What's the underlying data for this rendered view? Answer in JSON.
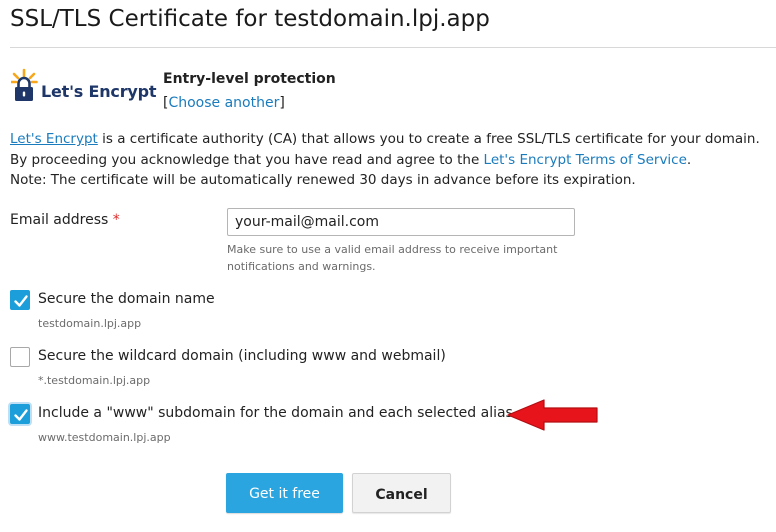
{
  "page": {
    "title": "SSL/TLS Certificate for testdomain.lpj.app"
  },
  "provider": {
    "logo_text": "Let's Encrypt",
    "level": "Entry-level protection",
    "choose_prefix": "[",
    "choose_link": "Choose another",
    "choose_suffix": "]",
    "logo_colors": {
      "text": "#1e3768",
      "rays": "#f7a71b",
      "lock": "#1e3768"
    }
  },
  "description": {
    "line1_link": "Let's Encrypt",
    "line1_text": " is a certificate authority (CA) that allows you to create a free SSL/TLS certificate for your domain.",
    "line2_text": "By proceeding you acknowledge that you have read and agree to the ",
    "line2_link": "Let's Encrypt Terms of Service",
    "line2_end": ".",
    "line3_text": "Note: The certificate will be automatically renewed 30 days in advance before its expiration."
  },
  "email": {
    "label": "Email address",
    "required_mark": "*",
    "value": "your-mail@mail.com",
    "hint": "Make sure to use a valid email address to receive important notifications and warnings."
  },
  "options": [
    {
      "label": "Secure the domain name",
      "sub": "testdomain.lpj.app",
      "checked": true
    },
    {
      "label": "Secure the wildcard domain (including www and webmail)",
      "sub": "*.testdomain.lpj.app",
      "checked": false
    },
    {
      "label": "Include a \"www\" subdomain for the domain and each selected alias",
      "sub": "www.testdomain.lpj.app",
      "checked": true
    }
  ],
  "annotation": {
    "arrow_color": "#e8141b"
  },
  "buttons": {
    "primary": "Get it free",
    "secondary": "Cancel"
  },
  "colors": {
    "accent": "#2aa5e0",
    "checkbox": "#1b9ed9",
    "link": "#1a7bbd"
  }
}
